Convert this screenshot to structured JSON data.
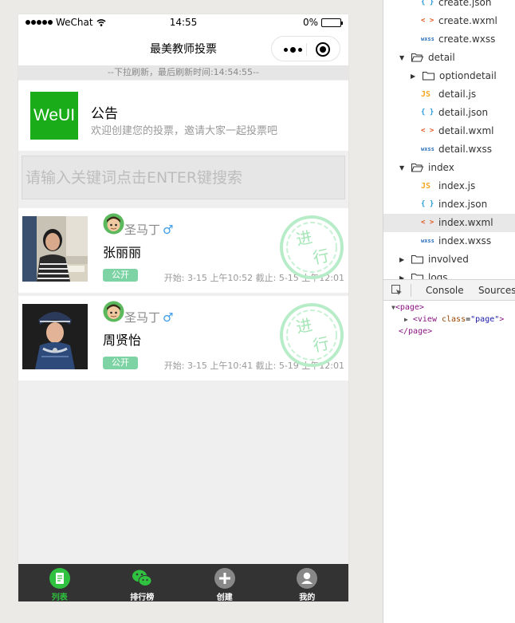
{
  "status_bar": {
    "carrier": "WeChat",
    "time": "14:55",
    "battery": "0%"
  },
  "nav": {
    "title": "最美教师投票"
  },
  "refresh_text": "--下拉刷新，最后刷新时间:14:54:55--",
  "notice": {
    "logo": "WeUI",
    "title": "公告",
    "desc": "欢迎创建您的投票，邀请大家一起投票吧"
  },
  "search": {
    "placeholder": "请输入关键词点击ENTER键搜索",
    "value": ""
  },
  "cards": [
    {
      "author": "圣马丁",
      "gender": "♂",
      "name": "张丽丽",
      "badge": "公开",
      "time": "开始: 3-15 上午10:52 截止: 5-15 上午12:01",
      "stamp": "进行"
    },
    {
      "author": "圣马丁",
      "gender": "♂",
      "name": "周贤怡",
      "badge": "公开",
      "time": "开始: 3-15 上午10:41 截止: 5-19 上午12:01",
      "stamp": "进行"
    }
  ],
  "tabbar": [
    {
      "label": "列表",
      "icon": "list-icon",
      "active": true
    },
    {
      "label": "排行榜",
      "icon": "wechat-icon",
      "active": false
    },
    {
      "label": "创建",
      "icon": "plus-icon",
      "active": false
    },
    {
      "label": "我的",
      "icon": "user-icon",
      "active": false
    }
  ],
  "colors": {
    "accent": "#1aad19",
    "tab_active": "#2fc13f",
    "badge": "#7ed3a4",
    "tabbar_bg": "#333333"
  },
  "devtools": {
    "tree": [
      {
        "label": "create.json",
        "kind": "json",
        "depth": 2
      },
      {
        "label": "create.wxml",
        "kind": "wxml",
        "depth": 2
      },
      {
        "label": "create.wxss",
        "kind": "wxss",
        "depth": 2
      },
      {
        "label": "detail",
        "kind": "folder-open",
        "depth": 1
      },
      {
        "label": "optiondetail",
        "kind": "folder-closed",
        "depth": 2
      },
      {
        "label": "detail.js",
        "kind": "js",
        "depth": 2
      },
      {
        "label": "detail.json",
        "kind": "json",
        "depth": 2
      },
      {
        "label": "detail.wxml",
        "kind": "wxml",
        "depth": 2
      },
      {
        "label": "detail.wxss",
        "kind": "wxss",
        "depth": 2
      },
      {
        "label": "index",
        "kind": "folder-open",
        "depth": 1
      },
      {
        "label": "index.js",
        "kind": "js",
        "depth": 2
      },
      {
        "label": "index.json",
        "kind": "json",
        "depth": 2
      },
      {
        "label": "index.wxml",
        "kind": "wxml",
        "depth": 2,
        "selected": true
      },
      {
        "label": "index.wxss",
        "kind": "wxss",
        "depth": 2
      },
      {
        "label": "involved",
        "kind": "folder-closed",
        "depth": 1
      },
      {
        "label": "logs",
        "kind": "folder-closed",
        "depth": 1
      }
    ],
    "tabs": [
      "Console",
      "Sources"
    ],
    "dom": {
      "line1": "<page>",
      "line2_tag_open": "<view",
      "line2_attr_name": "class",
      "line2_attr_value": "\"page\"",
      "line2_tag_close": ">",
      "line3": "</page>"
    }
  }
}
